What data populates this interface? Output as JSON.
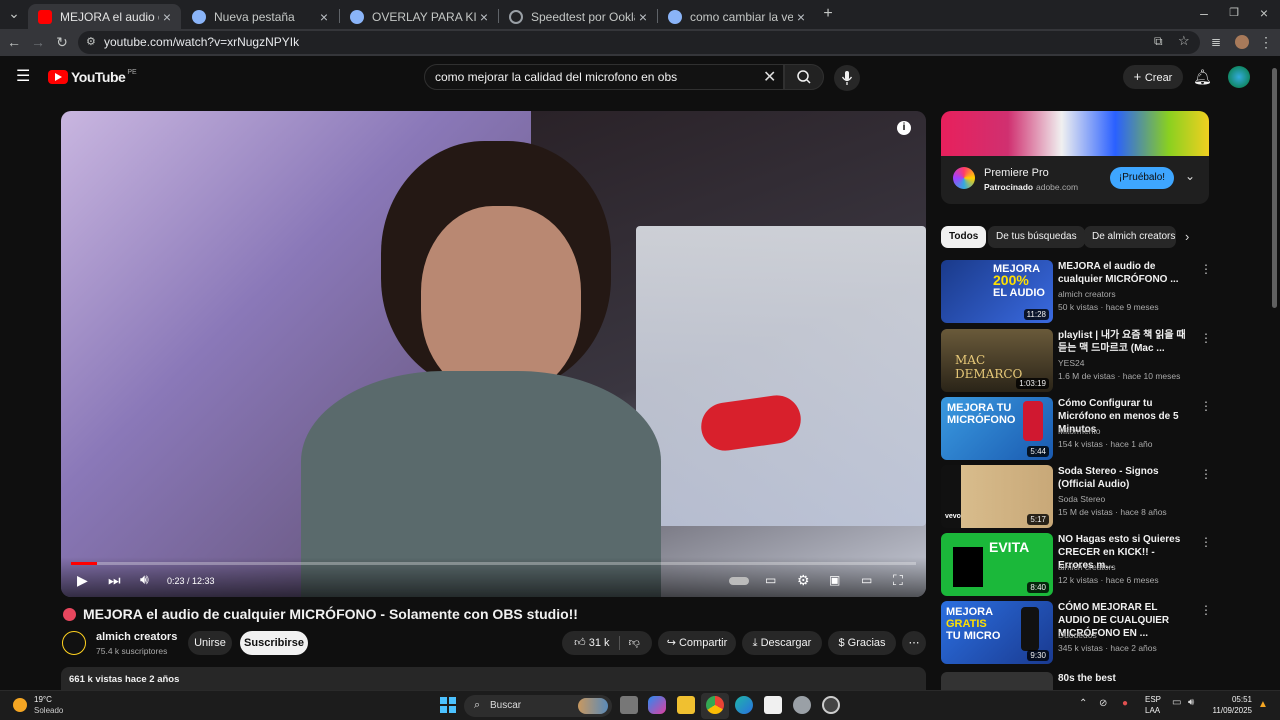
{
  "browser": {
    "tabs": [
      {
        "title": "MEJORA el audio de cualquier",
        "color": "#ff0000"
      },
      {
        "title": "Nueva pestaña",
        "color": "#8ab4f8"
      },
      {
        "title": "OVERLAY PARA KICK - Buscar con",
        "color": "#8ab4f8"
      },
      {
        "title": "Speedtest por Ookla - La prueba",
        "color": "#9aa0a6"
      },
      {
        "title": "como cambiar la velocidad de su",
        "color": "#8ab4f8"
      }
    ],
    "url": "youtube.com/watch?v=xrNugzNPYIk"
  },
  "header": {
    "logo": "YouTube",
    "region": "PE",
    "search_query": "como mejorar la calidad del microfono en obs",
    "create_label": "Crear"
  },
  "player": {
    "time": "0:23 / 12:33",
    "progress_fraction": 0.031
  },
  "video": {
    "title": "MEJORA el audio de cualquier MICRÓFONO - Solamente con OBS studio!!",
    "channel": "almich creators",
    "subscribers": "75.4 k suscriptores",
    "join_label": "Unirse",
    "subscribe_label": "Suscribirse",
    "likes": "31 k",
    "share_label": "Compartir",
    "download_label": "Descargar",
    "thanks_label": "Gracias",
    "views_line": "661 k vistas  hace 2 años"
  },
  "ad": {
    "name": "Premiere Pro",
    "sponsored": "Patrocinado",
    "domain": "adobe.com",
    "cta": "¡Pruébalo!"
  },
  "chips": [
    "Todos",
    "De tus búsquedas",
    "De almich creators"
  ],
  "recommendations": [
    {
      "title": "MEJORA el audio de cualquier MICRÓFONO ...",
      "channel": "almich creators",
      "stats": "50 k vistas · hace 9 meses",
      "duration": "11:28",
      "thumb_color": "#1a3a8a"
    },
    {
      "title": "playlist | 내가 요즘 책 읽을 때 듣는 맥 드마르코 (Mac ...",
      "channel": "YES24",
      "stats": "1.6 M de vistas · hace 10 meses",
      "duration": "1:03:19",
      "thumb_color": "#4a3a20"
    },
    {
      "title": "Cómo Configurar tu Micrófono en menos de 5 Minutos",
      "channel": "Mitormento",
      "stats": "154 k vistas · hace 1 año",
      "duration": "5:44",
      "thumb_color": "#2a7ad0"
    },
    {
      "title": "Soda Stereo - Signos (Official Audio)",
      "channel": "Soda Stereo",
      "stats": "15 M de vistas · hace 8 años",
      "duration": "5:17",
      "thumb_color": "#c8a878"
    },
    {
      "title": "NO Hagas esto si Quieres CRECER en KICK!! - Errores m...",
      "channel": "almich creators",
      "stats": "12 k vistas · hace 6 meses",
      "duration": "8:40",
      "thumb_color": "#1bb83a"
    },
    {
      "title": "CÓMO MEJORAR EL AUDIO DE CUALQUIER MICRÓFONO EN ...",
      "channel": "Duodedos",
      "stats": "345 k vistas · hace 2 años",
      "duration": "9:30",
      "thumb_color": "#2b6fe0"
    },
    {
      "title": "80s the best",
      "channel": "",
      "stats": "",
      "duration": "",
      "thumb_color": "#333333"
    }
  ],
  "taskbar": {
    "weather_temp": "19°C",
    "weather_desc": "Soleado",
    "search_label": "Buscar",
    "lang": "ESP",
    "lang_sub": "LAA",
    "time": "05:51",
    "date": "11/09/2025"
  }
}
